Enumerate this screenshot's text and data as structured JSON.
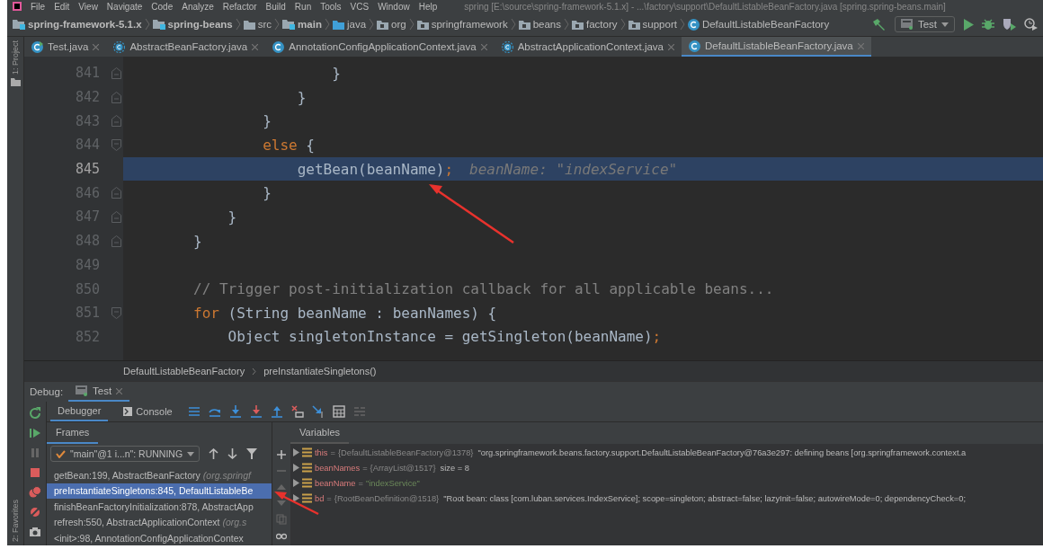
{
  "window": {
    "title": "spring [E:\\source\\spring-framework-5.1.x] - ...\\factory\\support\\DefaultListableBeanFactory.java [spring.spring-beans.main]"
  },
  "menu": [
    "File",
    "Edit",
    "View",
    "Navigate",
    "Code",
    "Analyze",
    "Refactor",
    "Build",
    "Run",
    "Tools",
    "VCS",
    "Window",
    "Help"
  ],
  "breadcrumbs": [
    {
      "label": "spring-framework-5.1.x",
      "kind": "module"
    },
    {
      "label": "spring-beans",
      "kind": "module"
    },
    {
      "label": "src",
      "kind": "folder"
    },
    {
      "label": "main",
      "kind": "module"
    },
    {
      "label": "java",
      "kind": "source"
    },
    {
      "label": "org",
      "kind": "package"
    },
    {
      "label": "springframework",
      "kind": "package"
    },
    {
      "label": "beans",
      "kind": "package"
    },
    {
      "label": "factory",
      "kind": "package"
    },
    {
      "label": "support",
      "kind": "package"
    },
    {
      "label": "DefaultListableBeanFactory",
      "kind": "class"
    }
  ],
  "run_config": {
    "label": "Test"
  },
  "tabs": [
    {
      "label": "Test.java",
      "kind": "runnable",
      "selected": false
    },
    {
      "label": "AbstractBeanFactory.java",
      "kind": "abstract",
      "selected": false
    },
    {
      "label": "AnnotationConfigApplicationContext.java",
      "kind": "class",
      "selected": false
    },
    {
      "label": "AbstractApplicationContext.java",
      "kind": "abstract",
      "selected": false
    },
    {
      "label": "DefaultListableBeanFactory.java",
      "kind": "class",
      "selected": true
    }
  ],
  "side_tools": {
    "top": "1: Project",
    "bottom": "2: Favorites"
  },
  "editor": {
    "lines": [
      {
        "number": "841",
        "fold_open": false,
        "fold_close": true,
        "current": false,
        "segments": [
          {
            "kind": "plain",
            "text": "                        }"
          }
        ]
      },
      {
        "number": "842",
        "fold_open": false,
        "fold_close": true,
        "current": false,
        "segments": [
          {
            "kind": "plain",
            "text": "                    }"
          }
        ]
      },
      {
        "number": "843",
        "fold_open": false,
        "fold_close": true,
        "current": false,
        "segments": [
          {
            "kind": "plain",
            "text": "                }"
          }
        ]
      },
      {
        "number": "844",
        "fold_open": true,
        "fold_close": false,
        "current": false,
        "segments": [
          {
            "kind": "keyword",
            "text": "                else"
          },
          {
            "kind": "plain",
            "text": " {"
          }
        ]
      },
      {
        "number": "845",
        "fold_open": false,
        "fold_close": false,
        "current": true,
        "marked": true,
        "segments": [
          {
            "kind": "plain",
            "text": "                    getBean(beanName)"
          },
          {
            "kind": "keyword",
            "text": ";"
          }
        ],
        "hint": "beanName: \"indexService\""
      },
      {
        "number": "846",
        "fold_open": false,
        "fold_close": true,
        "current": false,
        "segments": [
          {
            "kind": "plain",
            "text": "                }"
          }
        ]
      },
      {
        "number": "847",
        "fold_open": false,
        "fold_close": true,
        "current": false,
        "segments": [
          {
            "kind": "plain",
            "text": "            }"
          }
        ]
      },
      {
        "number": "848",
        "fold_open": false,
        "fold_close": true,
        "current": false,
        "segments": [
          {
            "kind": "plain",
            "text": "        }"
          }
        ]
      },
      {
        "number": "849",
        "fold_open": false,
        "fold_close": false,
        "current": false
      },
      {
        "number": "850",
        "fold_open": false,
        "fold_close": false,
        "current": false,
        "segments": [
          {
            "kind": "comment",
            "text": "        // Trigger post-initialization callback for all applicable beans..."
          }
        ]
      },
      {
        "number": "851",
        "fold_open": true,
        "fold_close": false,
        "current": false,
        "segments": [
          {
            "kind": "keyword",
            "text": "        for"
          },
          {
            "kind": "plain",
            "text": " (String beanName : beanNames) {"
          }
        ]
      },
      {
        "number": "852",
        "fold_open": false,
        "fold_close": false,
        "current": false,
        "segments": [
          {
            "kind": "plain",
            "text": "            Object singletonInstance = getSingleton(beanName)"
          },
          {
            "kind": "keyword",
            "text": ";"
          }
        ]
      }
    ]
  },
  "editor_breadcrumbs": [
    "DefaultListableBeanFactory",
    "preInstantiateSingletons()"
  ],
  "debug": {
    "label": "Debug:",
    "session_tab": "Test",
    "tabs": [
      {
        "label": "Debugger",
        "kind": "debugger",
        "selected": true
      },
      {
        "label": "Console",
        "kind": "console",
        "selected": false
      }
    ],
    "frames_title": "Frames",
    "variables_title": "Variables",
    "thread": "\"main\"@1 i...n\": RUNNING",
    "frames": [
      {
        "method": "getBean:199, AbstractBeanFactory",
        "package": "(org.springf",
        "selected": false,
        "marked": false
      },
      {
        "method": "preInstantiateSingletons:845, DefaultListableBe",
        "selected": true,
        "marked": true
      },
      {
        "method": "finishBeanFactoryInitialization:878, AbstractApp",
        "selected": false,
        "marked": false
      },
      {
        "method": "refresh:550, AbstractApplicationContext",
        "package": "(org.s",
        "selected": false,
        "marked": false
      },
      {
        "method": "<init>:98, AnnotationConfigApplicationContex",
        "selected": false,
        "marked": false
      }
    ],
    "variables": [
      {
        "name": "this",
        "sep": "=",
        "value": "{DefaultListableBeanFactory@1378}",
        "kind": "object",
        "detail": "\"org.springframework.beans.factory.support.DefaultListableBeanFactory@76a3e297: defining beans [org.springframework.context.a"
      },
      {
        "name": "beanNames",
        "sep": "=",
        "value": "{ArrayList@1517}",
        "kind": "object",
        "detail": "size = 8"
      },
      {
        "name": "beanName",
        "sep": "=",
        "value": "\"indexService\"",
        "kind": "string"
      },
      {
        "name": "bd",
        "sep": "=",
        "value": "{RootBeanDefinition@1518}",
        "kind": "object",
        "detail": "\"Root bean: class [com.luban.services.IndexService]; scope=singleton; abstract=false; lazyInit=false; autowireMode=0; dependencyCheck=0;"
      }
    ]
  }
}
